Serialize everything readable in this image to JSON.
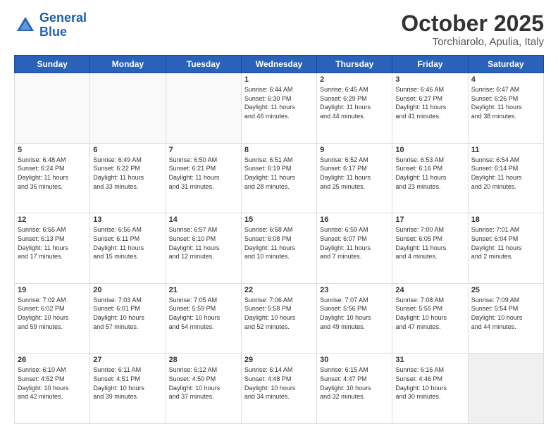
{
  "header": {
    "logo_line1": "General",
    "logo_line2": "Blue",
    "month": "October 2025",
    "location": "Torchiarolo, Apulia, Italy"
  },
  "weekdays": [
    "Sunday",
    "Monday",
    "Tuesday",
    "Wednesday",
    "Thursday",
    "Friday",
    "Saturday"
  ],
  "weeks": [
    [
      {
        "day": "",
        "info": ""
      },
      {
        "day": "",
        "info": ""
      },
      {
        "day": "",
        "info": ""
      },
      {
        "day": "1",
        "info": "Sunrise: 6:44 AM\nSunset: 6:30 PM\nDaylight: 11 hours\nand 46 minutes."
      },
      {
        "day": "2",
        "info": "Sunrise: 6:45 AM\nSunset: 6:29 PM\nDaylight: 11 hours\nand 44 minutes."
      },
      {
        "day": "3",
        "info": "Sunrise: 6:46 AM\nSunset: 6:27 PM\nDaylight: 11 hours\nand 41 minutes."
      },
      {
        "day": "4",
        "info": "Sunrise: 6:47 AM\nSunset: 6:26 PM\nDaylight: 11 hours\nand 38 minutes."
      }
    ],
    [
      {
        "day": "5",
        "info": "Sunrise: 6:48 AM\nSunset: 6:24 PM\nDaylight: 11 hours\nand 36 minutes."
      },
      {
        "day": "6",
        "info": "Sunrise: 6:49 AM\nSunset: 6:22 PM\nDaylight: 11 hours\nand 33 minutes."
      },
      {
        "day": "7",
        "info": "Sunrise: 6:50 AM\nSunset: 6:21 PM\nDaylight: 11 hours\nand 31 minutes."
      },
      {
        "day": "8",
        "info": "Sunrise: 6:51 AM\nSunset: 6:19 PM\nDaylight: 11 hours\nand 28 minutes."
      },
      {
        "day": "9",
        "info": "Sunrise: 6:52 AM\nSunset: 6:17 PM\nDaylight: 11 hours\nand 25 minutes."
      },
      {
        "day": "10",
        "info": "Sunrise: 6:53 AM\nSunset: 6:16 PM\nDaylight: 11 hours\nand 23 minutes."
      },
      {
        "day": "11",
        "info": "Sunrise: 6:54 AM\nSunset: 6:14 PM\nDaylight: 11 hours\nand 20 minutes."
      }
    ],
    [
      {
        "day": "12",
        "info": "Sunrise: 6:55 AM\nSunset: 6:13 PM\nDaylight: 11 hours\nand 17 minutes."
      },
      {
        "day": "13",
        "info": "Sunrise: 6:56 AM\nSunset: 6:11 PM\nDaylight: 11 hours\nand 15 minutes."
      },
      {
        "day": "14",
        "info": "Sunrise: 6:57 AM\nSunset: 6:10 PM\nDaylight: 11 hours\nand 12 minutes."
      },
      {
        "day": "15",
        "info": "Sunrise: 6:58 AM\nSunset: 6:08 PM\nDaylight: 11 hours\nand 10 minutes."
      },
      {
        "day": "16",
        "info": "Sunrise: 6:59 AM\nSunset: 6:07 PM\nDaylight: 11 hours\nand 7 minutes."
      },
      {
        "day": "17",
        "info": "Sunrise: 7:00 AM\nSunset: 6:05 PM\nDaylight: 11 hours\nand 4 minutes."
      },
      {
        "day": "18",
        "info": "Sunrise: 7:01 AM\nSunset: 6:04 PM\nDaylight: 11 hours\nand 2 minutes."
      }
    ],
    [
      {
        "day": "19",
        "info": "Sunrise: 7:02 AM\nSunset: 6:02 PM\nDaylight: 10 hours\nand 59 minutes."
      },
      {
        "day": "20",
        "info": "Sunrise: 7:03 AM\nSunset: 6:01 PM\nDaylight: 10 hours\nand 57 minutes."
      },
      {
        "day": "21",
        "info": "Sunrise: 7:05 AM\nSunset: 5:59 PM\nDaylight: 10 hours\nand 54 minutes."
      },
      {
        "day": "22",
        "info": "Sunrise: 7:06 AM\nSunset: 5:58 PM\nDaylight: 10 hours\nand 52 minutes."
      },
      {
        "day": "23",
        "info": "Sunrise: 7:07 AM\nSunset: 5:56 PM\nDaylight: 10 hours\nand 49 minutes."
      },
      {
        "day": "24",
        "info": "Sunrise: 7:08 AM\nSunset: 5:55 PM\nDaylight: 10 hours\nand 47 minutes."
      },
      {
        "day": "25",
        "info": "Sunrise: 7:09 AM\nSunset: 5:54 PM\nDaylight: 10 hours\nand 44 minutes."
      }
    ],
    [
      {
        "day": "26",
        "info": "Sunrise: 6:10 AM\nSunset: 4:52 PM\nDaylight: 10 hours\nand 42 minutes."
      },
      {
        "day": "27",
        "info": "Sunrise: 6:11 AM\nSunset: 4:51 PM\nDaylight: 10 hours\nand 39 minutes."
      },
      {
        "day": "28",
        "info": "Sunrise: 6:12 AM\nSunset: 4:50 PM\nDaylight: 10 hours\nand 37 minutes."
      },
      {
        "day": "29",
        "info": "Sunrise: 6:14 AM\nSunset: 4:48 PM\nDaylight: 10 hours\nand 34 minutes."
      },
      {
        "day": "30",
        "info": "Sunrise: 6:15 AM\nSunset: 4:47 PM\nDaylight: 10 hours\nand 32 minutes."
      },
      {
        "day": "31",
        "info": "Sunrise: 6:16 AM\nSunset: 4:46 PM\nDaylight: 10 hours\nand 30 minutes."
      },
      {
        "day": "",
        "info": ""
      }
    ]
  ]
}
